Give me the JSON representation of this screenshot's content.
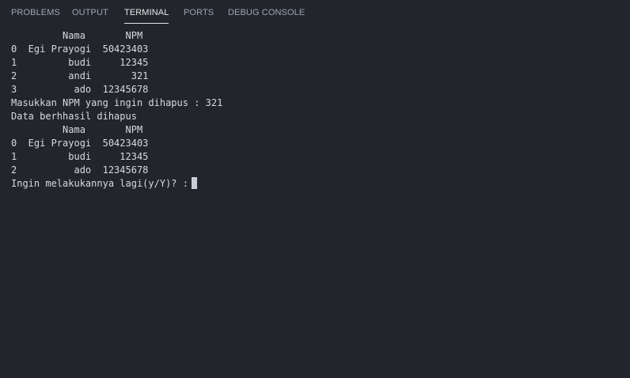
{
  "tabs": [
    {
      "label": "PROBLEMS"
    },
    {
      "label": "OUTPUT"
    },
    {
      "label": "TERMINAL"
    },
    {
      "label": "PORTS"
    },
    {
      "label": "DEBUG CONSOLE"
    }
  ],
  "terminal": {
    "lines": [
      "         Nama       NPM",
      "0  Egi Prayogi  50423403",
      "1         budi     12345",
      "2         andi       321",
      "3          ado  12345678",
      "Masukkan NPM yang ingin dihapus : 321",
      "Data berhhasil dihapus",
      "         Nama       NPM",
      "0  Egi Prayogi  50423403",
      "1         budi     12345",
      "2          ado  12345678"
    ],
    "prompt": "Ingin melakukannya lagi(y/Y)? :"
  }
}
